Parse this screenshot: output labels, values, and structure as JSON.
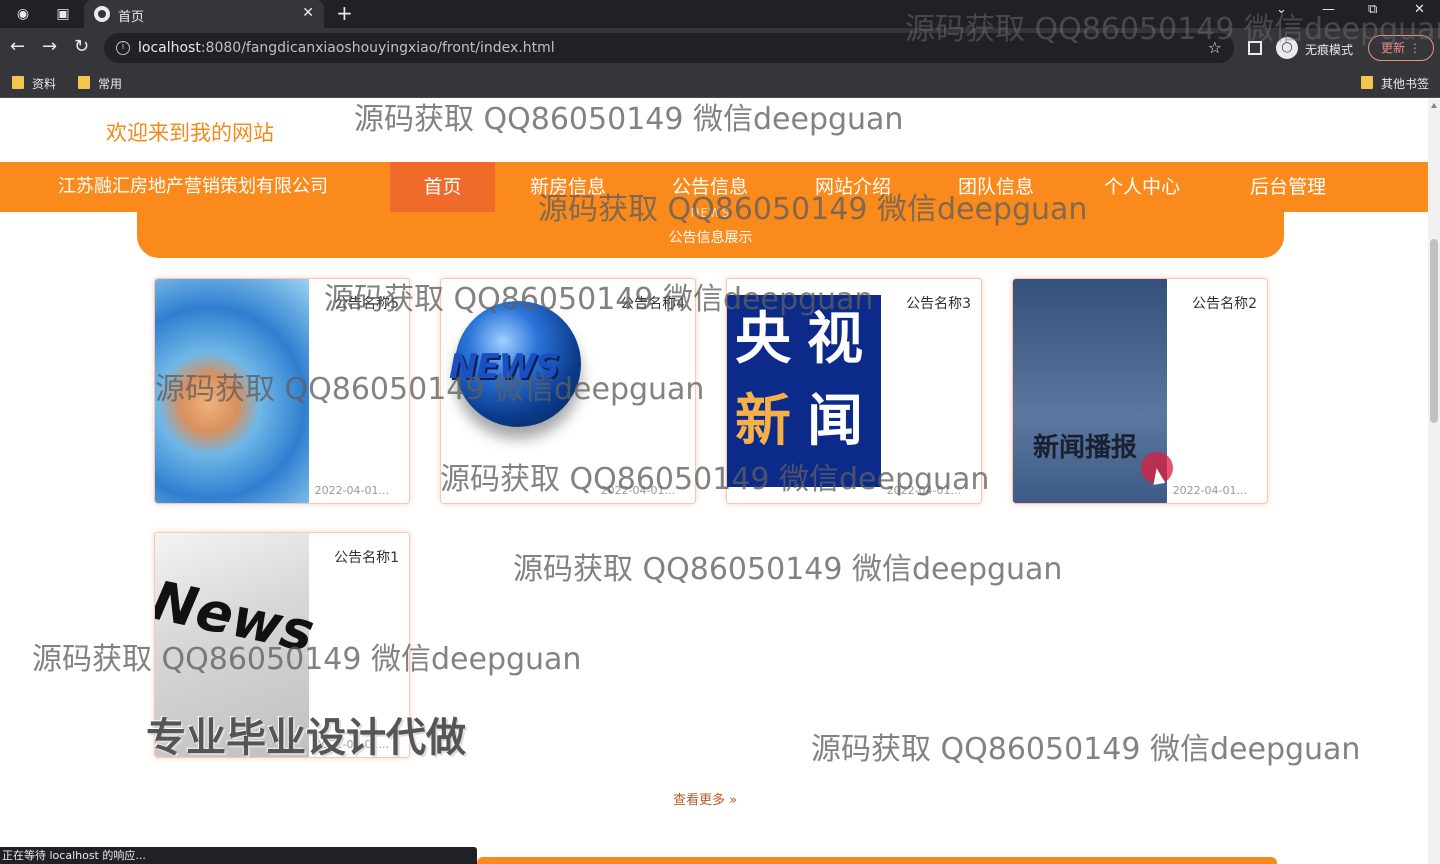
{
  "browser": {
    "tab_title": "首页",
    "url_host": "localhost",
    "url_path": ":8080/fangdicanxiaoshouyingxiao/front/index.html",
    "incognito_label": "无痕模式",
    "update_label": "更新",
    "bookmarks": [
      "资料",
      "常用",
      "其他书签"
    ],
    "status_text": "正在等待 localhost 的响应..."
  },
  "site": {
    "welcome": "欢迎来到我的网站",
    "brand": "江苏融汇房地产营销策划有限公司",
    "nav": [
      "首页",
      "新房信息",
      "公告信息",
      "网站介绍",
      "团队信息",
      "个人中心",
      "后台管理"
    ],
    "section_en": "NEWS",
    "section_title": "公告信息展示",
    "more_label": "查看更多",
    "cards": [
      {
        "title": "公告名称5",
        "date": "2022-04-01...",
        "image": "news-studio-image"
      },
      {
        "title": "公告名称4",
        "date": "2022-04-01...",
        "image": "news-globe-image",
        "image_text": "NEWS"
      },
      {
        "title": "公告名称3",
        "date": "2022-04-01...",
        "image": "cctv-news-image",
        "image_text": [
          "央",
          "视",
          "新",
          "闻"
        ]
      },
      {
        "title": "公告名称2",
        "date": "2022-04-01...",
        "image": "news-broadcast-image",
        "image_text": "新闻播报"
      },
      {
        "title": "公告名称1",
        "date": "2022-04-01...",
        "image": "newspaper-image",
        "image_text": "News"
      }
    ]
  },
  "overlay": {
    "watermark": "源码获取 QQ86050149 微信deepguan",
    "banner": "专业毕业设计代做"
  },
  "colors": {
    "primary": "#fb8a1c",
    "nav_active": "#f06a2a",
    "welcome_text": "#f28a1a"
  }
}
